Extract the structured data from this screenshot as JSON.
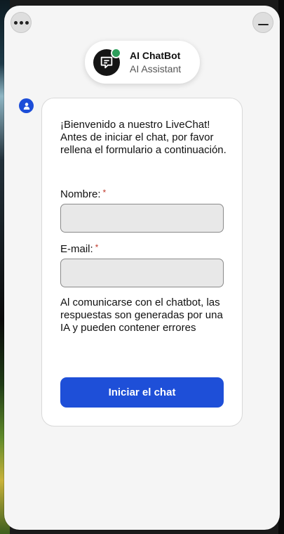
{
  "header": {
    "menu_icon": "more-horizontal-icon",
    "minimize_icon": "minimize-icon"
  },
  "agent": {
    "name": "AI ChatBot",
    "role": "AI Assistant",
    "avatar_icon": "chat-bubble-icon",
    "status_color": "#2e9e5b"
  },
  "form": {
    "welcome_text": "¡Bienvenido a nuestro LiveChat! Antes de iniciar el chat, por favor rellena el formulario a continuación.",
    "name_label": "Nombre:",
    "email_label": "E-mail:",
    "required_mark": "*",
    "name_value": "",
    "email_value": "",
    "disclaimer": "Al comunicarse con el chatbot, las respuestas son generadas por una IA y pueden contener errores",
    "submit_label": "Iniciar el chat"
  },
  "colors": {
    "accent": "#1e4fd8",
    "required": "#c0392b",
    "background": "#f5f5f5"
  }
}
